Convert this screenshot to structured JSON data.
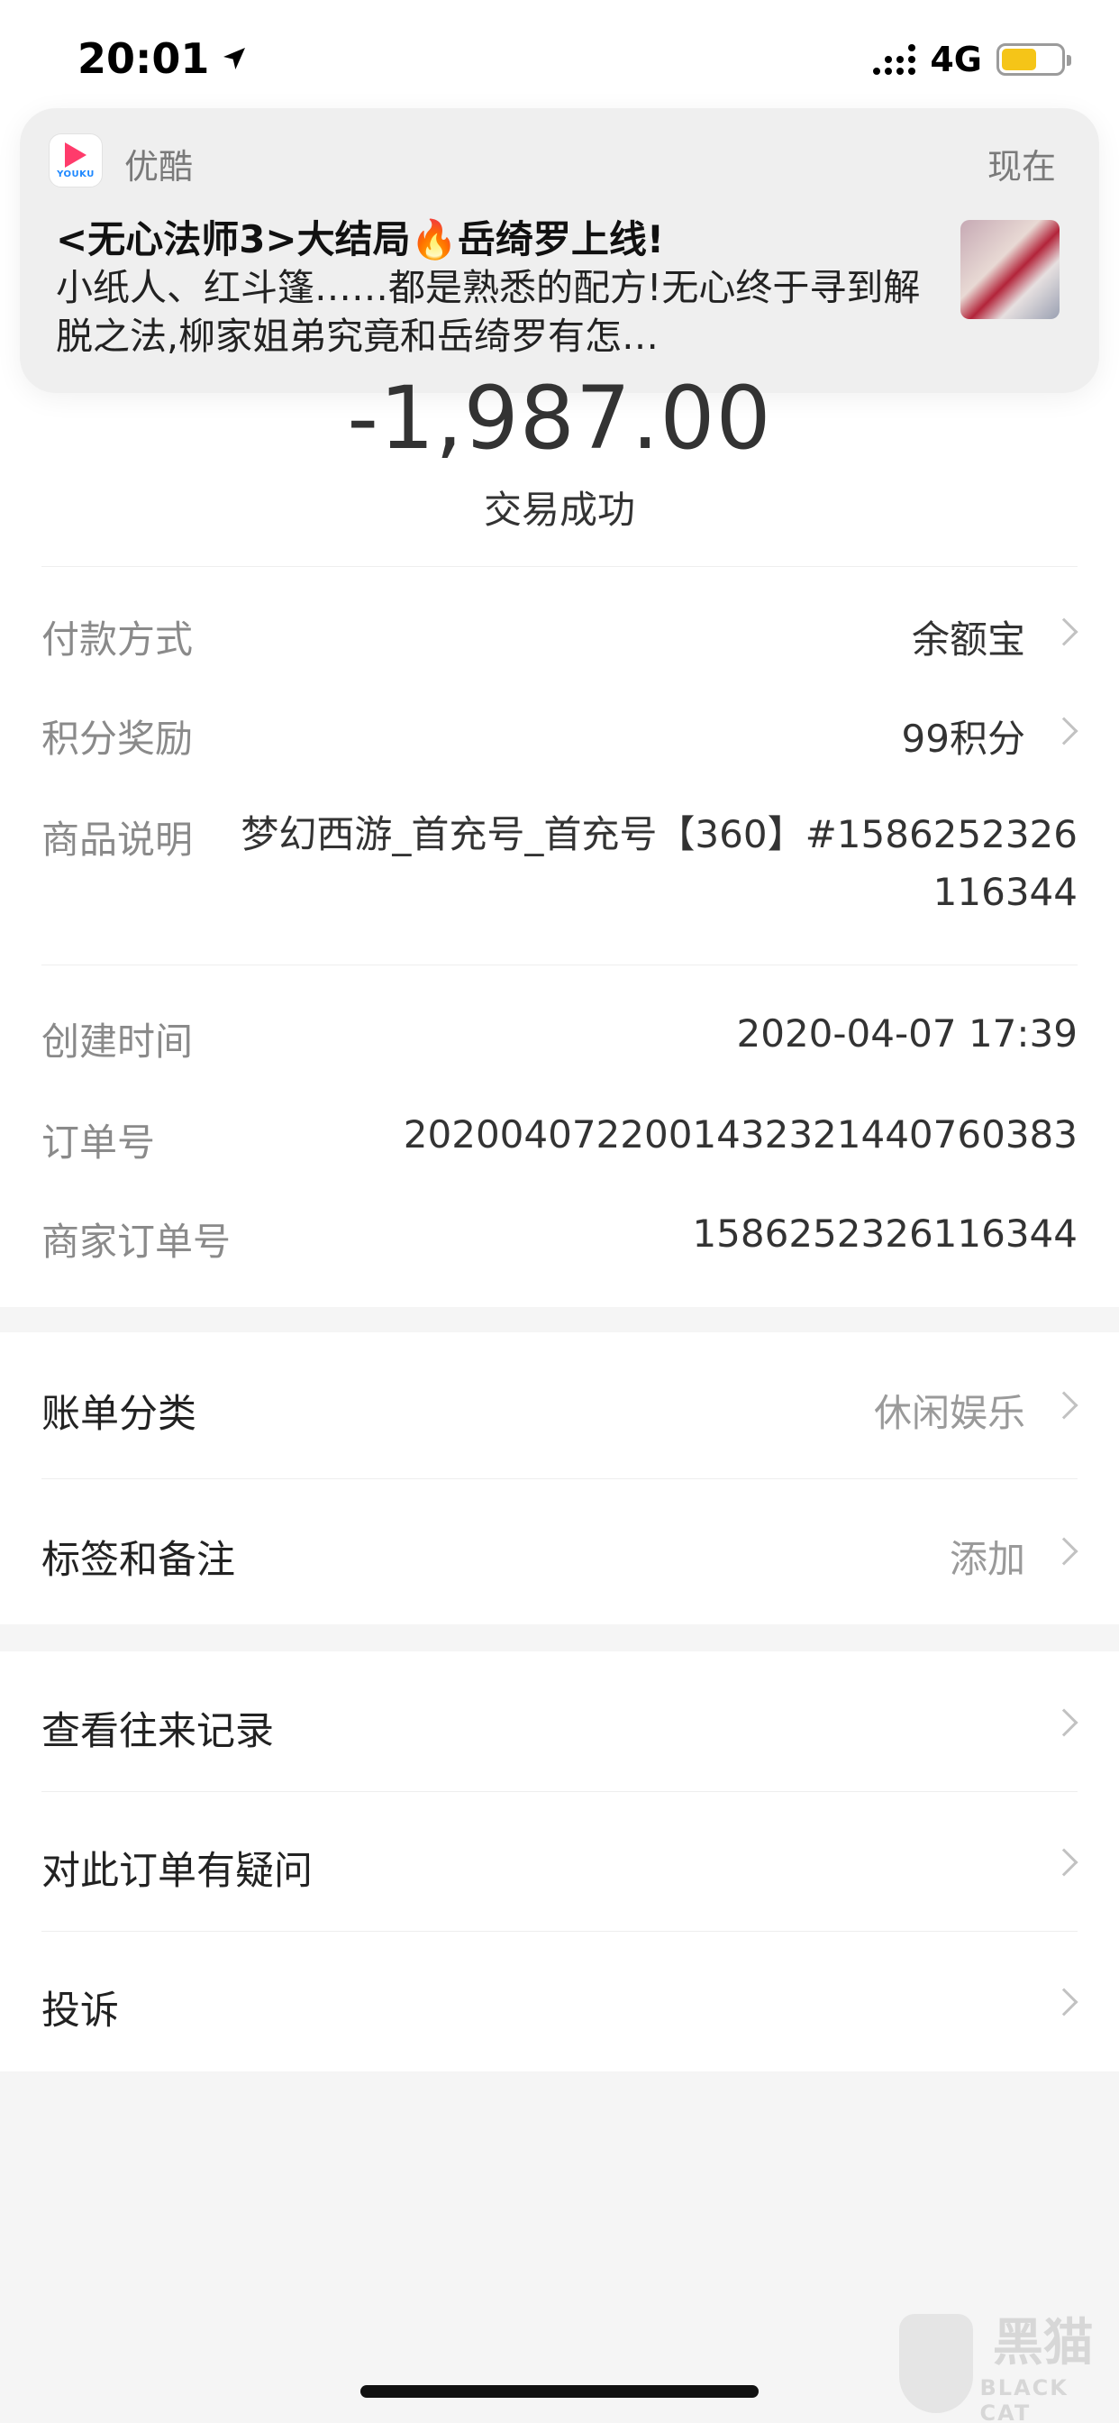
{
  "status_bar": {
    "time": "20:01",
    "network": "4G"
  },
  "notification": {
    "app_name": "优酷",
    "app_icon_text": "YOUKU",
    "time": "现在",
    "title": "<无心法师3>大结局🔥岳绮罗上线!",
    "body": "小纸人、红斗篷……都是熟悉的配方!无心终于寻到解脱之法,柳家姐弟究竟和岳绮罗有怎…"
  },
  "transaction": {
    "amount": "-1,987.00",
    "status": "交易成功"
  },
  "details": {
    "payment_method_label": "付款方式",
    "payment_method_value": "余额宝",
    "points_label": "积分奖励",
    "points_value": "99积分",
    "description_label": "商品说明",
    "description_value": "梦幻西游_首充号_首充号【360】#1586252326116344",
    "created_label": "创建时间",
    "created_value": "2020-04-07 17:39",
    "order_no_label": "订单号",
    "order_no_value": "2020040722001432321440760383",
    "merchant_order_label": "商家订单号",
    "merchant_order_value": "1586252326116344"
  },
  "category_section": {
    "category_label": "账单分类",
    "category_value": "休闲娱乐",
    "tags_label": "标签和备注",
    "tags_value": "添加"
  },
  "actions": {
    "history_label": "查看往来记录",
    "question_label": "对此订单有疑问",
    "complaint_label": "投诉"
  },
  "watermark": {
    "cn": "黑猫",
    "en": "BLACK CAT"
  },
  "colors": {
    "accent_battery": "#f5c518",
    "youku_red": "#ff3b6b",
    "youku_blue": "#1e88ff"
  }
}
